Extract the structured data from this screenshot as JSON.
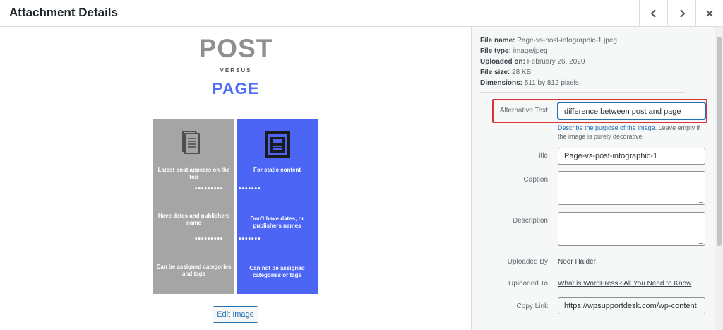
{
  "header": {
    "title": "Attachment Details",
    "prev_icon": "chevron-left-icon",
    "next_icon": "chevron-right-icon",
    "close_icon": "close-icon"
  },
  "infographic": {
    "title_top": "POST",
    "versus": "VERSUS",
    "title_bottom": "PAGE",
    "left_items": [
      "Latest post appears on the top",
      "Have dates and publishers name",
      "Can be assigned categories and tags"
    ],
    "right_items": [
      "For static content",
      "Don't have dates, or publishers names",
      "Can not be assigned categories or tags"
    ],
    "left_color": "#a5a5a5",
    "right_color": "#4d65f5"
  },
  "edit_button": "Edit Image",
  "file_info": {
    "name_label": "File name:",
    "name_value": "Page-vs-post-infographic-1.jpeg",
    "type_label": "File type:",
    "type_value": "image/jpeg",
    "uploaded_label": "Uploaded on:",
    "uploaded_value": "February 26, 2020",
    "size_label": "File size:",
    "size_value": "28 KB",
    "dimensions_label": "Dimensions:",
    "dimensions_value": "511 by 812 pixels"
  },
  "fields": {
    "alt_label": "Alternative Text",
    "alt_value": "difference between post and page",
    "alt_help_link": "Describe the purpose of the image",
    "alt_help_rest": ". Leave empty if the image is purely decorative.",
    "title_label": "Title",
    "title_value": "Page-vs-post-infographic-1",
    "caption_label": "Caption",
    "caption_value": "",
    "description_label": "Description",
    "description_value": "",
    "uploaded_by_label": "Uploaded By",
    "uploaded_by_value": "Noor Haider",
    "uploaded_to_label": "Uploaded To",
    "uploaded_to_value": "What is WordPress? All You Need to Know",
    "copy_link_label": "Copy Link",
    "copy_link_value": "https://wpsupportdesk.com/wp-content"
  },
  "colors": {
    "accent": "#2271b1",
    "highlight": "#d63638"
  }
}
